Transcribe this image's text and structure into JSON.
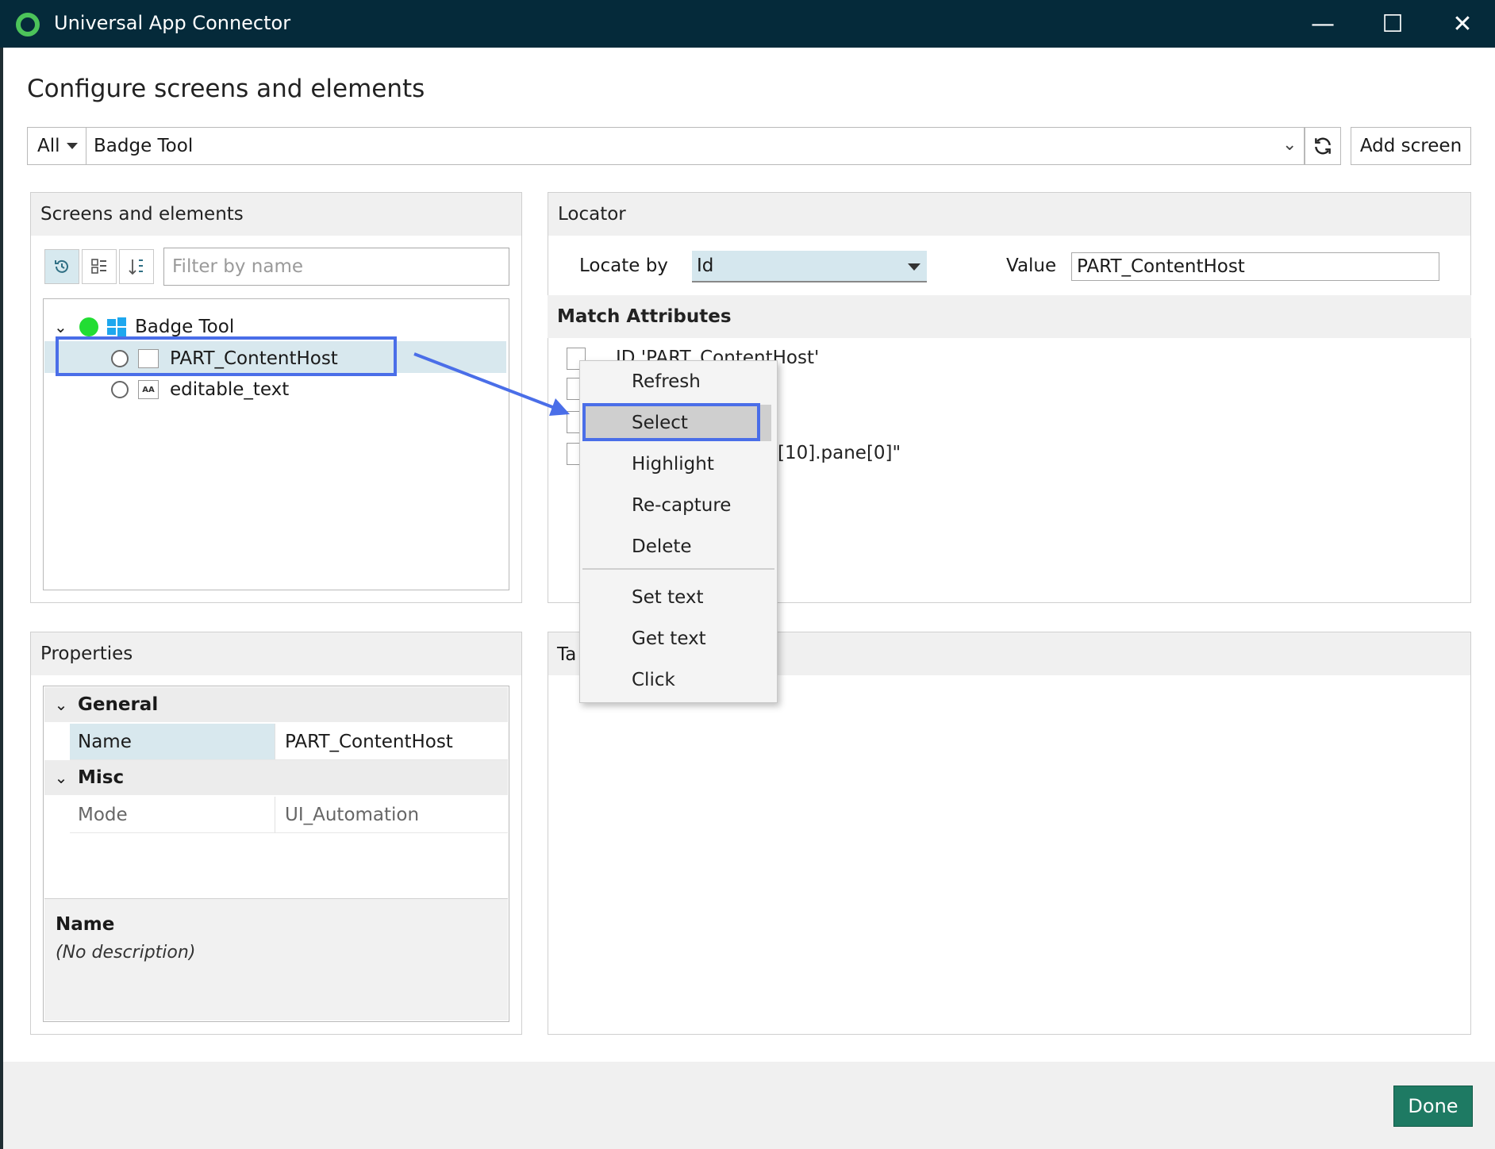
{
  "window": {
    "title": "Universal App Connector",
    "minimize_glyph": "—",
    "maximize_glyph": "☐",
    "close_glyph": "✕"
  },
  "page": {
    "title": "Configure screens and elements"
  },
  "toolbar": {
    "filter_all": "All",
    "screen_selected": "Badge Tool",
    "add_screen_label": "Add screen"
  },
  "screens_panel": {
    "header": "Screens and elements",
    "filter_placeholder": "Filter by name",
    "tree": {
      "root": "Badge Tool",
      "children": [
        "PART_ContentHost",
        "editable_text"
      ]
    }
  },
  "locator_panel": {
    "header": "Locator",
    "locate_by_label": "Locate by",
    "locate_by_value": "Id",
    "value_label": "Value",
    "value_value": "PART_ContentHost",
    "match_attributes_header": "Match Attributes",
    "match_rows": [
      "ID    'PART_ContentHost'",
      "[10].pane[0]\""
    ]
  },
  "context_menu": {
    "items": [
      "Refresh",
      "Select",
      "Highlight",
      "Re-capture",
      "Delete",
      "Set text",
      "Get text",
      "Click"
    ]
  },
  "properties_panel": {
    "header": "Properties",
    "categories": [
      {
        "name": "General",
        "props": [
          {
            "name": "Name",
            "value": "PART_ContentHost"
          }
        ]
      },
      {
        "name": "Misc",
        "props": [
          {
            "name": "Mode",
            "value": "UI_Automation"
          }
        ]
      }
    ],
    "description_title": "Name",
    "description_text": "(No description)"
  },
  "target_panel": {
    "header_partial": "Ta"
  },
  "footer": {
    "done_label": "Done"
  },
  "colors": {
    "titlebar": "#052a3a",
    "accent_green": "#4cc35a",
    "done_button": "#1e7a63",
    "highlight_blue": "#4a6ee8",
    "selection": "#d8e8ee"
  }
}
